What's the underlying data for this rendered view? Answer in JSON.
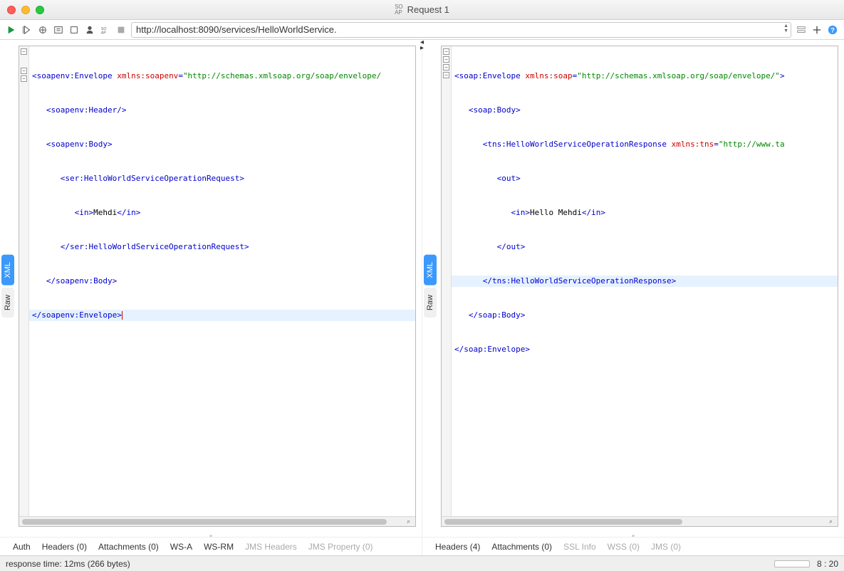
{
  "window": {
    "title": "Request 1"
  },
  "toolbar": {
    "url": "http://localhost:8090/services/HelloWorldService."
  },
  "request": {
    "side_tabs": {
      "xml": "XML",
      "raw": "Raw"
    },
    "code": {
      "l1a": "<",
      "l1b": "soapenv:Envelope",
      "l1c": " xmlns:soapenv",
      "l1d": "=",
      "l1e": "\"http://schemas.xmlsoap.org/soap/envelope/",
      "l2a": "   <",
      "l2b": "soapenv:Header",
      "l2c": "/>",
      "l3a": "   <",
      "l3b": "soapenv:Body",
      "l3c": ">",
      "l4a": "      <",
      "l4b": "ser:HelloWorldServiceOperationRequest",
      "l4c": ">",
      "l5a": "         <",
      "l5b": "in",
      "l5c": ">",
      "l5d": "Mehdi",
      "l5e": "</",
      "l5f": "in",
      "l5g": ">",
      "l6a": "      </",
      "l6b": "ser:HelloWorldServiceOperationRequest",
      "l6c": ">",
      "l7a": "   </",
      "l7b": "soapenv:Body",
      "l7c": ">",
      "l8a": "</",
      "l8b": "soapenv:Envelope",
      "l8c": ">"
    },
    "bottom_tabs": {
      "auth": "Auth",
      "headers": "Headers (0)",
      "attachments": "Attachments (0)",
      "wsa": "WS-A",
      "wsrm": "WS-RM",
      "jms_headers": "JMS Headers",
      "jms_property": "JMS Property (0)"
    }
  },
  "response": {
    "side_tabs": {
      "xml": "XML",
      "raw": "Raw"
    },
    "code": {
      "l1a": "<",
      "l1b": "soap:Envelope",
      "l1c": " xmlns:soap",
      "l1d": "=",
      "l1e": "\"http://schemas.xmlsoap.org/soap/envelope/\"",
      "l1f": ">",
      "l2a": "   <",
      "l2b": "soap:Body",
      "l2c": ">",
      "l3a": "      <",
      "l3b": "tns:HelloWorldServiceOperationResponse",
      "l3c": " xmlns:tns",
      "l3d": "=",
      "l3e": "\"http://www.ta",
      "l4a": "         <",
      "l4b": "out",
      "l4c": ">",
      "l5a": "            <",
      "l5b": "in",
      "l5c": ">",
      "l5d": "Hello Mehdi",
      "l5e": "</",
      "l5f": "in",
      "l5g": ">",
      "l6a": "         </",
      "l6b": "out",
      "l6c": ">",
      "l7a": "      </",
      "l7b": "tns:HelloWorldServiceOperationResponse",
      "l7c": ">",
      "l8a": "   </",
      "l8b": "soap:Body",
      "l8c": ">",
      "l9a": "</",
      "l9b": "soap:Envelope",
      "l9c": ">"
    },
    "bottom_tabs": {
      "headers": "Headers (4)",
      "attachments": "Attachments (0)",
      "ssl": "SSL Info",
      "wss": "WSS (0)",
      "jms": "JMS (0)"
    }
  },
  "statusbar": {
    "left": "response time: 12ms (266 bytes)",
    "right": "8 : 20"
  }
}
